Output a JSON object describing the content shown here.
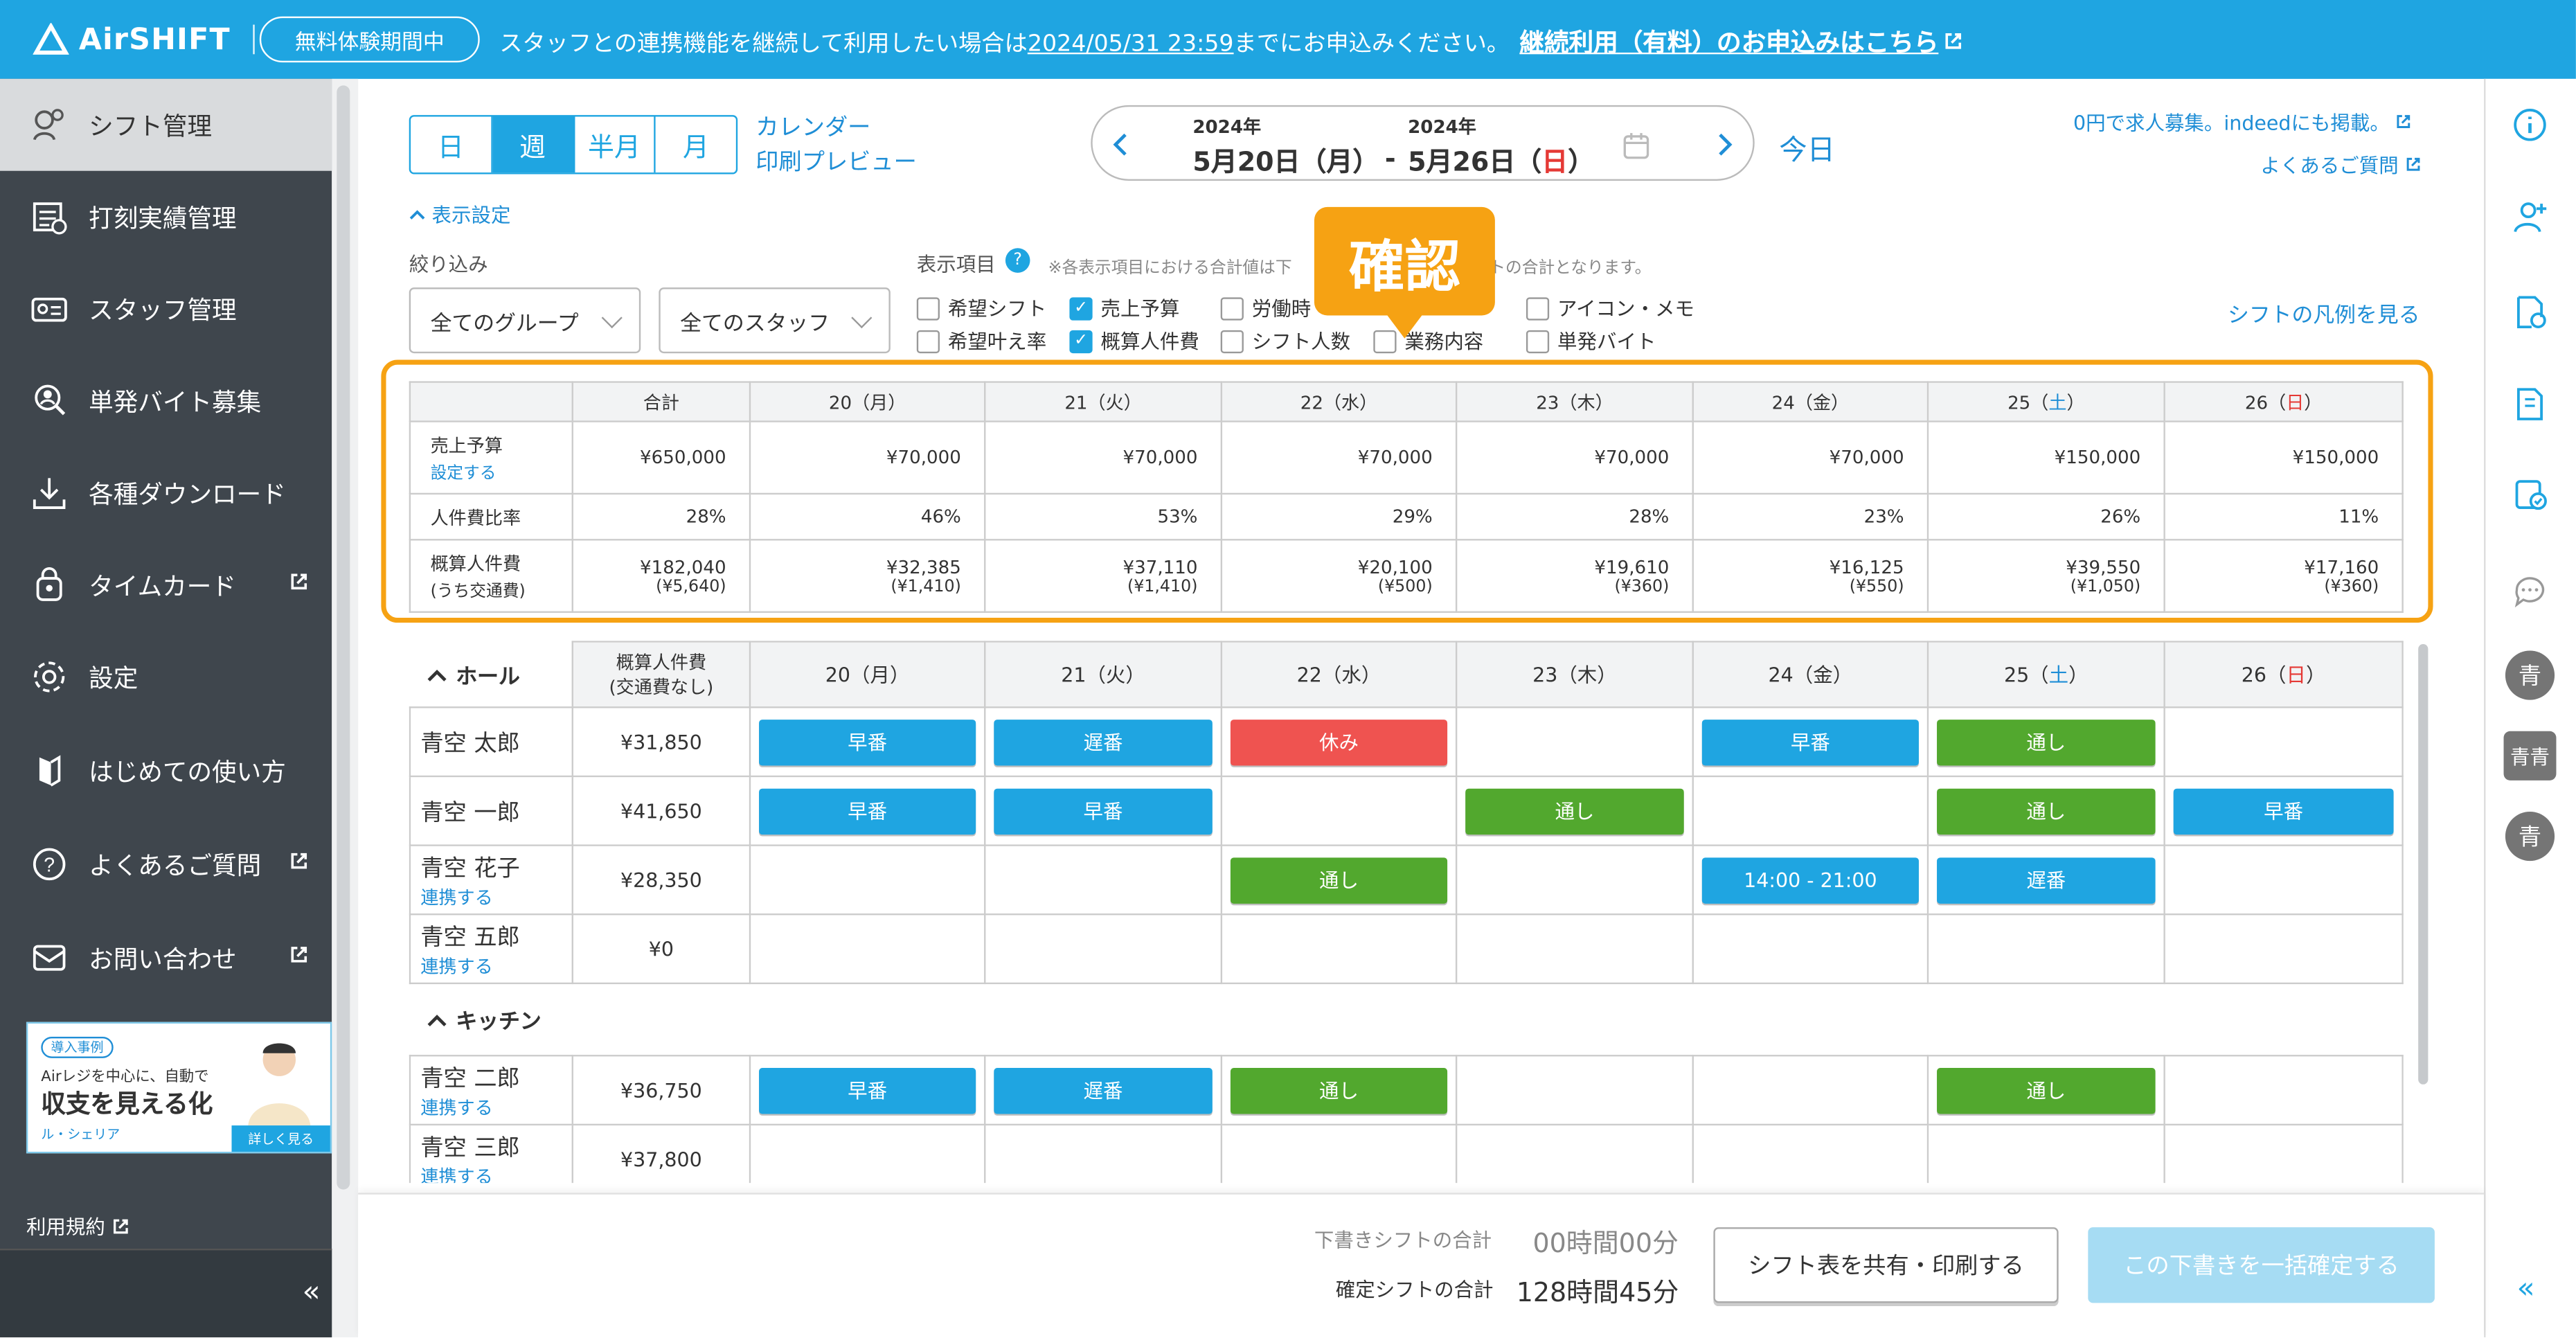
{
  "header": {
    "logo": "AirSHIFT",
    "trial_badge": "無料体験期間中",
    "banner_pre": "スタッフとの連携機能を継続して利用したい場合は",
    "banner_date": "2024/05/31 23:59",
    "banner_post": "までにお申込みください。",
    "banner_link": "継続利用（有料）のお申込みはこちら"
  },
  "sidebar": {
    "items": [
      {
        "label": "シフト管理",
        "icon": "shift-icon"
      },
      {
        "label": "打刻実績管理",
        "icon": "timestamp-icon"
      },
      {
        "label": "スタッフ管理",
        "icon": "staff-icon"
      },
      {
        "label": "単発バイト募集",
        "icon": "recruit-icon"
      },
      {
        "label": "各種ダウンロード",
        "icon": "download-icon"
      },
      {
        "label": "タイムカード",
        "icon": "timecard-icon"
      },
      {
        "label": "設定",
        "icon": "gear-icon"
      },
      {
        "label": "はじめての使い方",
        "icon": "guide-icon"
      },
      {
        "label": "よくあるご質問",
        "icon": "question-icon"
      },
      {
        "label": "お問い合わせ",
        "icon": "mail-icon"
      }
    ],
    "ad": {
      "tag": "導入事例",
      "line1": "Airレジを中心に、自動で",
      "line2": "収支を見える化",
      "brand": "ル・シェリア",
      "more": "詳しく見る"
    },
    "terms": "利用規約",
    "collapse": "«"
  },
  "toolbar": {
    "view_tabs": [
      "日",
      "週",
      "半月",
      "月"
    ],
    "calendar_link": "カレンダー",
    "print_link": "印刷プレビュー",
    "year_start": "2024年",
    "date_start": "5月20日（月）",
    "dash": "-",
    "year_end": "2024年",
    "date_end_pre": "5月26日（",
    "date_end_day": "日",
    "date_end_post": "）",
    "today": "今日",
    "indeed": "0円で求人募集。indeedにも掲載。",
    "faq": "よくあるご質問"
  },
  "display": {
    "toggle": "表示設定",
    "filter_label": "絞り込み",
    "group_select": "全てのグループ",
    "staff_select": "全てのスタッフ",
    "items_label": "表示項目",
    "note": "※各表示項目における合計値は下",
    "note2": "トの合計となります。",
    "checkboxes": [
      {
        "label": "希望シフト",
        "checked": false
      },
      {
        "label": "売上予算",
        "checked": true
      },
      {
        "label": "労働時",
        "checked": false
      },
      {
        "label": "アイコン・メモ",
        "checked": false
      },
      {
        "label": "希望叶え率",
        "checked": false
      },
      {
        "label": "概算人件費",
        "checked": true
      },
      {
        "label": "シフト人数",
        "checked": false
      },
      {
        "label": "業務内容",
        "checked": false
      },
      {
        "label": "単発バイト",
        "checked": false
      }
    ],
    "legend_link": "シフトの凡例を見る",
    "callout": "確認"
  },
  "summary": {
    "headers": [
      "合計",
      "20（月）",
      "21（火）",
      "22（水）",
      "23（木）",
      "24（金）",
      "25（",
      "26（"
    ],
    "sat": "土",
    "sun": "日",
    "close": "）",
    "rows": [
      {
        "label": "売上予算",
        "sublink": "設定する",
        "values": [
          "¥650,000",
          "¥70,000",
          "¥70,000",
          "¥70,000",
          "¥70,000",
          "¥70,000",
          "¥150,000",
          "¥150,000"
        ]
      },
      {
        "label": "人件費比率",
        "values": [
          "28%",
          "46%",
          "53%",
          "29%",
          "28%",
          "23%",
          "26%",
          "11%"
        ]
      },
      {
        "label": "概算人件費",
        "label2": "(うち交通費)",
        "values": [
          "¥182,040",
          "¥32,385",
          "¥37,110",
          "¥20,100",
          "¥19,610",
          "¥16,125",
          "¥39,550",
          "¥17,160"
        ],
        "sub": [
          "(¥5,640)",
          "(¥1,410)",
          "(¥1,410)",
          "(¥500)",
          "(¥360)",
          "(¥550)",
          "(¥1,050)",
          "(¥360)"
        ]
      }
    ]
  },
  "shift": {
    "hall_title": "ホール",
    "cost_header": "概算人件費",
    "cost_header2": "(交通費なし)",
    "kitchen_title": "キッチン",
    "connect_link": "連携する",
    "staff": [
      {
        "name": "青空 太郎",
        "cost": "¥31,850",
        "link": false,
        "shifts": [
          [
            "早番",
            "blue"
          ],
          [
            "遅番",
            "blue"
          ],
          [
            "休み",
            "red"
          ],
          null,
          [
            "早番",
            "blue"
          ],
          [
            "通し",
            "green"
          ],
          null
        ]
      },
      {
        "name": "青空 一郎",
        "cost": "¥41,650",
        "link": false,
        "shifts": [
          [
            "早番",
            "blue"
          ],
          [
            "早番",
            "blue"
          ],
          null,
          [
            "通し",
            "green"
          ],
          null,
          [
            "通し",
            "green"
          ],
          [
            "早番",
            "blue"
          ]
        ]
      },
      {
        "name": "青空 花子",
        "cost": "¥28,350",
        "link": true,
        "shifts": [
          null,
          null,
          [
            "通し",
            "green"
          ],
          null,
          [
            "14:00 - 21:00",
            "blue"
          ],
          [
            "遅番",
            "blue"
          ],
          null
        ]
      },
      {
        "name": "青空 五郎",
        "cost": "¥0",
        "link": true,
        "shifts": [
          null,
          null,
          null,
          null,
          null,
          null,
          null
        ]
      }
    ],
    "kitchen_staff": [
      {
        "name": "青空 二郎",
        "cost": "¥36,750",
        "link": true,
        "shifts": [
          [
            "早番",
            "blue"
          ],
          [
            "遅番",
            "blue"
          ],
          [
            "通し",
            "green"
          ],
          null,
          null,
          [
            "通し",
            "green"
          ],
          null
        ]
      },
      {
        "name": "青空 三郎",
        "cost": "¥37,800",
        "link": true,
        "shifts": [
          null,
          null,
          null,
          null,
          null,
          null,
          null
        ]
      }
    ]
  },
  "footer": {
    "draft_label": "下書きシフトの合計",
    "draft_value": "00時間00分",
    "confirmed_label": "確定シフトの合計",
    "confirmed_value": "128時間45分",
    "share_button": "シフト表を共有・印刷する",
    "confirm_button": "この下書きを一括確定する"
  },
  "right_rail": {
    "avatars": [
      "青",
      "青青",
      "青"
    ],
    "collapse": "«"
  },
  "colors": {
    "brand": "#1fa5e1",
    "callout": "#f6a213",
    "early": "#1fa5e1",
    "full": "#52a82e",
    "off": "#ef5350",
    "sidebar": "#3f464d"
  }
}
